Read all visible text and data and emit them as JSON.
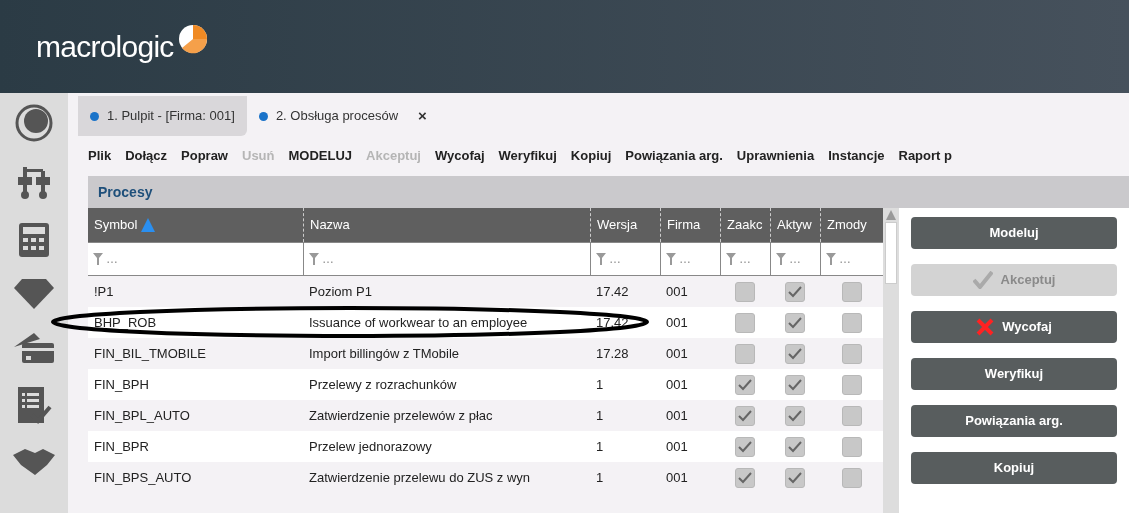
{
  "header": {
    "logo": "macrologic"
  },
  "tabs": [
    {
      "label": "1. Pulpit - [Firma: 001]",
      "selected": false,
      "closable": false
    },
    {
      "label": "2. Obsługa procesów",
      "selected": true,
      "closable": true,
      "close": "×"
    }
  ],
  "toolbar": [
    {
      "label": "Plik",
      "disabled": false
    },
    {
      "label": "Dołącz",
      "disabled": false
    },
    {
      "label": "Popraw",
      "disabled": false
    },
    {
      "label": "Usuń",
      "disabled": true
    },
    {
      "label": "MODELUJ",
      "disabled": false
    },
    {
      "label": "Akceptuj",
      "disabled": true
    },
    {
      "label": "Wycofaj",
      "disabled": false
    },
    {
      "label": "Weryfikuj",
      "disabled": false
    },
    {
      "label": "Kopiuj",
      "disabled": false
    },
    {
      "label": "Powiązania arg.",
      "disabled": false
    },
    {
      "label": "Uprawnienia",
      "disabled": false
    },
    {
      "label": "Instancje",
      "disabled": false
    },
    {
      "label": "Raport p",
      "disabled": false
    }
  ],
  "panel_title": "Procesy",
  "table": {
    "columns": [
      {
        "label": "Symbol",
        "sorted": true
      },
      {
        "label": "Nazwa",
        "sorted": false
      },
      {
        "label": "Wersja",
        "sorted": false
      },
      {
        "label": "Firma",
        "sorted": false
      },
      {
        "label": "Zaakc",
        "sorted": false
      },
      {
        "label": "Aktyw",
        "sorted": false
      },
      {
        "label": "Zmody",
        "sorted": false
      }
    ],
    "filter_placeholder": "…",
    "rows": [
      {
        "symbol": "!P1",
        "name": "Poziom P1",
        "version": "17.42",
        "firm": "001",
        "accepted": false,
        "active": true,
        "modified": false
      },
      {
        "symbol": "BHP_ROB",
        "name": "Issuance of workwear to an employee",
        "version": "17.42",
        "firm": "001",
        "accepted": false,
        "active": true,
        "modified": false
      },
      {
        "symbol": "FIN_BIL_TMOBILE",
        "name": "Import billingów z TMobile",
        "version": "17.28",
        "firm": "001",
        "accepted": false,
        "active": true,
        "modified": false
      },
      {
        "symbol": "FIN_BPH",
        "name": "Przelewy z rozrachunków",
        "version": "1",
        "firm": "001",
        "accepted": true,
        "active": true,
        "modified": false
      },
      {
        "symbol": "FIN_BPL_AUTO",
        "name": "Zatwierdzenie przelewów z płac",
        "version": "1",
        "firm": "001",
        "accepted": true,
        "active": true,
        "modified": false
      },
      {
        "symbol": "FIN_BPR",
        "name": "Przelew jednorazowy",
        "version": "1",
        "firm": "001",
        "accepted": true,
        "active": true,
        "modified": false
      },
      {
        "symbol": "FIN_BPS_AUTO",
        "name": "Zatwierdzenie przelewu do ZUS z wyn",
        "version": "1",
        "firm": "001",
        "accepted": true,
        "active": true,
        "modified": false
      }
    ]
  },
  "actions": [
    {
      "label": "Modeluj",
      "disabled": false,
      "kind": "plain"
    },
    {
      "label": "Akceptuj",
      "disabled": true,
      "kind": "check"
    },
    {
      "label": "Wycofaj",
      "disabled": false,
      "kind": "cross"
    },
    {
      "label": "Weryfikuj",
      "disabled": false,
      "kind": "plain"
    },
    {
      "label": "Powiązania arg.",
      "disabled": false,
      "kind": "plain"
    },
    {
      "label": "Kopiuj",
      "disabled": false,
      "kind": "plain"
    }
  ]
}
